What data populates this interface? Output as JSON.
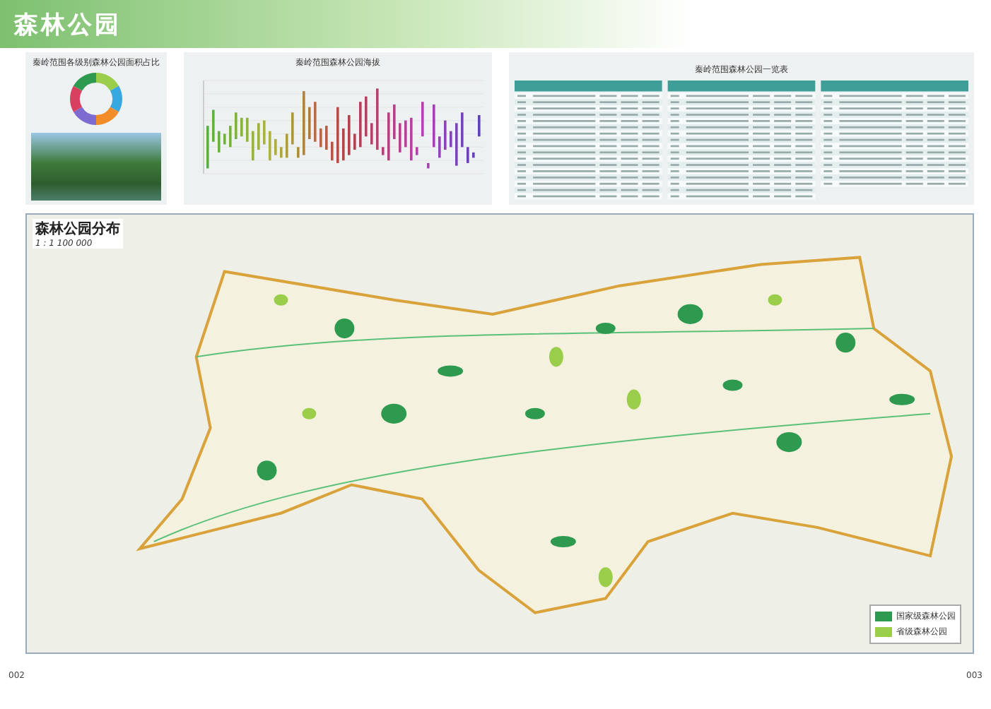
{
  "page_title": "森林公园",
  "area_panel": {
    "title": "秦岭范围各级别森林公园面积占比"
  },
  "altitude_chart": {
    "title": "秦岭范围森林公园海拔"
  },
  "table": {
    "title": "秦岭范围森林公园一览表"
  },
  "map": {
    "title": "森林公园分布",
    "scale": "1 : 1 100 000",
    "legend": [
      {
        "label": "国家级森林公园",
        "color": "#2e9a4f"
      },
      {
        "label": "省级森林公园",
        "color": "#9acd4a"
      }
    ]
  },
  "page_numbers": [
    "002",
    "003"
  ]
}
